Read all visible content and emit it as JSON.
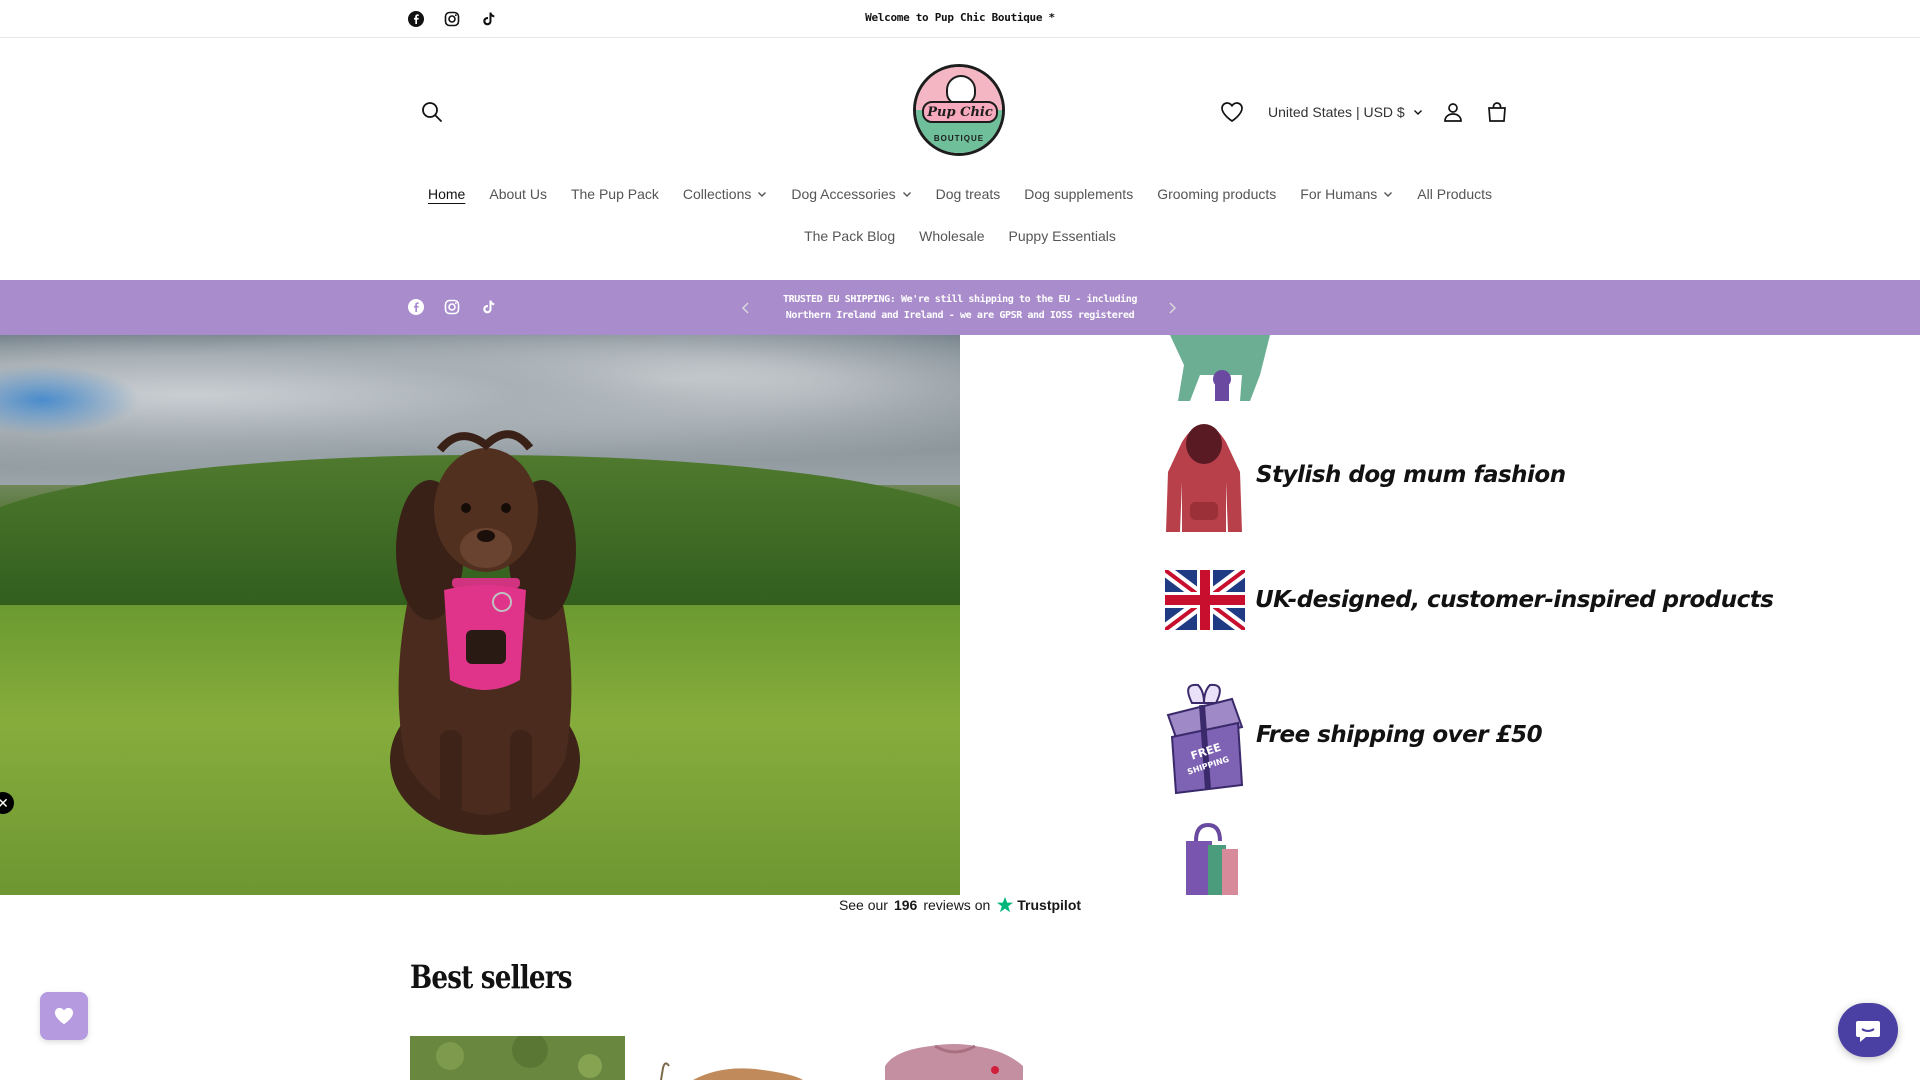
{
  "announcement": {
    "welcome_text": "Welcome to Pup Chic Boutique *",
    "social_icons": [
      "facebook-icon",
      "instagram-icon",
      "tiktok-icon"
    ]
  },
  "header": {
    "logo_title": "Pup Chic",
    "logo_subtitle": "BOUTIQUE",
    "country_selector": "United States | USD $",
    "icons": [
      "search-icon",
      "heart-icon",
      "account-icon",
      "cart-icon"
    ]
  },
  "nav": {
    "row1": [
      {
        "label": "Home",
        "active": true
      },
      {
        "label": "About Us"
      },
      {
        "label": "The Pup Pack"
      },
      {
        "label": "Collections",
        "dropdown": true
      },
      {
        "label": "Dog Accessories",
        "dropdown": true
      },
      {
        "label": "Dog treats"
      },
      {
        "label": "Dog supplements"
      },
      {
        "label": "Grooming products"
      },
      {
        "label": "For Humans",
        "dropdown": true
      },
      {
        "label": "All Products"
      }
    ],
    "row2": [
      {
        "label": "The Pack Blog"
      },
      {
        "label": "Wholesale"
      },
      {
        "label": "Puppy Essentials"
      }
    ]
  },
  "shipping_bar": {
    "text": "TRUSTED EU SHIPPING: We're still shipping to the EU - including Northern Ireland and Ireland - we are GPSR and IOSS registered",
    "background": "#a98ccc"
  },
  "features": [
    {
      "icon": "hoodie-icon",
      "text": "Stylish dog mum fashion"
    },
    {
      "icon": "uk-flag-icon",
      "text": "UK-designed, customer-inspired products"
    },
    {
      "icon": "gift-box-icon",
      "text": "Free shipping over £50",
      "badge": "FREE SHIPPING"
    }
  ],
  "trustpilot": {
    "prefix": "See our",
    "count": "196",
    "suffix": "reviews on",
    "brand": "Trustpilot"
  },
  "best_sellers": {
    "title": "Best sellers"
  },
  "colors": {
    "accent_purple": "#a98ccc",
    "wishlist_purple": "#b59ae0",
    "chat_purple": "#4a3fa3",
    "trustpilot_green": "#00b67a"
  }
}
